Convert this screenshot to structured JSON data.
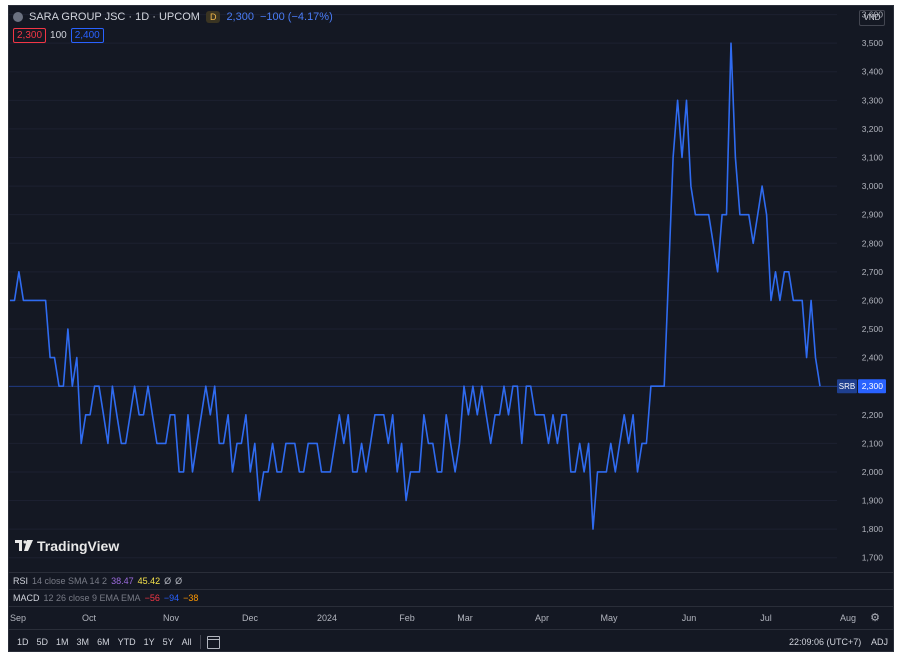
{
  "header": {
    "title": "SARA GROUP JSC · 1D · UPCOM",
    "badge": "D",
    "last_price": "2,300",
    "change": "−100 (−4.17%)",
    "low_box": "2,300",
    "spread": "100",
    "high_box": "2,400"
  },
  "currency": "VND",
  "branding": "TradingView",
  "indicators": {
    "rsi": {
      "name": "RSI",
      "params": "14 close SMA 14 2",
      "v1": "38.47",
      "v2": "45.42",
      "v3": "Ø",
      "v4": "Ø"
    },
    "macd": {
      "name": "MACD",
      "params": "12 26 close 9 EMA EMA",
      "v1": "−56",
      "v2": "−94",
      "v3": "−38"
    }
  },
  "time_labels": [
    "Sep",
    "Oct",
    "Nov",
    "Dec",
    "2024",
    "Feb",
    "Mar",
    "Apr",
    "May",
    "Jun",
    "Jul",
    "Aug"
  ],
  "ranges": [
    "1D",
    "5D",
    "1M",
    "3M",
    "6M",
    "YTD",
    "1Y",
    "5Y",
    "All"
  ],
  "clock": "22:09:06 (UTC+7)",
  "adj_label": "ADJ",
  "colors": {
    "line": "#2f6bf0",
    "background": "#141823",
    "price_tag": "#2962ff"
  },
  "chart_data": {
    "type": "line",
    "title": "SARA GROUP JSC · 1D · UPCOM",
    "ylim": [
      1650,
      3630
    ],
    "y_ticks": [
      1700,
      1800,
      1900,
      2000,
      2100,
      2200,
      2300,
      2400,
      2500,
      2600,
      2700,
      2800,
      2900,
      3000,
      3100,
      3200,
      3300,
      3400,
      3500,
      3600
    ],
    "x_ticks": [
      "Sep",
      "Oct",
      "Nov",
      "Dec",
      "2024",
      "Feb",
      "Mar",
      "Apr",
      "May",
      "Jun",
      "Jul",
      "Aug"
    ],
    "grid": true,
    "series": [
      {
        "values": [
          2600,
          2600,
          2700,
          2600,
          2600,
          2600,
          2600,
          2600,
          2600,
          2400,
          2400,
          2300,
          2300,
          2500,
          2300,
          2400,
          2100,
          2200,
          2200,
          2300,
          2300,
          2200,
          2100,
          2300,
          2200,
          2100,
          2100,
          2200,
          2300,
          2200,
          2200,
          2300,
          2200,
          2100,
          2100,
          2100,
          2200,
          2200,
          2000,
          2000,
          2200,
          2000,
          2100,
          2200,
          2300,
          2200,
          2300,
          2100,
          2100,
          2200,
          2000,
          2100,
          2100,
          2200,
          2000,
          2100,
          1900,
          2000,
          2000,
          2100,
          2000,
          2000,
          2100,
          2100,
          2100,
          2000,
          2000,
          2100,
          2100,
          2100,
          2000,
          2000,
          2000,
          2100,
          2200,
          2100,
          2200,
          2000,
          2000,
          2100,
          2000,
          2100,
          2200,
          2200,
          2200,
          2100,
          2200,
          2000,
          2100,
          1900,
          2000,
          2000,
          2000,
          2200,
          2100,
          2100,
          2000,
          2000,
          2200,
          2100,
          2000,
          2100,
          2300,
          2200,
          2300,
          2200,
          2300,
          2200,
          2100,
          2200,
          2200,
          2300,
          2200,
          2300,
          2300,
          2100,
          2300,
          2300,
          2200,
          2200,
          2200,
          2100,
          2200,
          2100,
          2200,
          2200,
          2000,
          2000,
          2100,
          2000,
          2100,
          1800,
          2000,
          2000,
          2000,
          2100,
          2000,
          2100,
          2200,
          2100,
          2200,
          2000,
          2100,
          2100,
          2300,
          2300,
          2300,
          2300,
          2700,
          3100,
          3300,
          3100,
          3300,
          3000,
          2900,
          2900,
          2900,
          2900,
          2800,
          2700,
          2900,
          2900,
          3500,
          3100,
          2900,
          2900,
          2900,
          2800,
          2900,
          3000,
          2900,
          2600,
          2700,
          2600,
          2700,
          2700,
          2600,
          2600,
          2600,
          2400,
          2600,
          2400,
          2300
        ],
        "last_value": "2,300",
        "symbol": "SRB"
      }
    ]
  }
}
